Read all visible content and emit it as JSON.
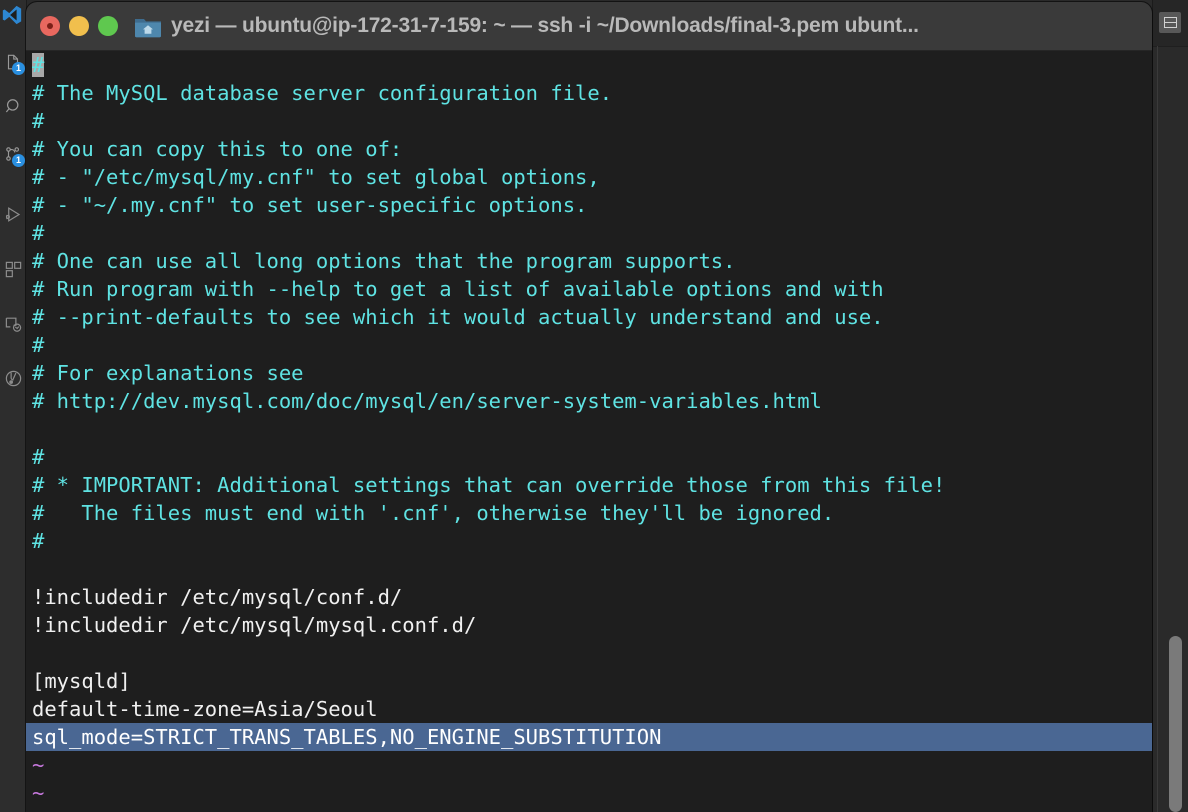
{
  "window": {
    "title": "yezi — ubuntu@ip-172-31-7-159: ~ — ssh -i ~/Downloads/final-3.pem ubunt...",
    "close_label": "Close",
    "minimize_label": "Minimize",
    "maximize_label": "Maximize",
    "folder_icon": "home-folder-icon"
  },
  "vscode": {
    "activity_items": [
      {
        "name": "explorer-icon",
        "badge": "1"
      },
      {
        "name": "search-icon",
        "badge": ""
      },
      {
        "name": "source-control-icon",
        "badge": "1"
      },
      {
        "name": "run-and-debug-icon",
        "badge": ""
      },
      {
        "name": "extensions-icon",
        "badge": ""
      },
      {
        "name": "remote-explorer-icon",
        "badge": ""
      },
      {
        "name": "testing-icon",
        "badge": ""
      }
    ],
    "editor_action": "split-editor-icon"
  },
  "terminal": {
    "program": "vim",
    "colors": {
      "background": "#1e1e1e",
      "comment": "#5fe3e3",
      "text": "#f0f0f0",
      "tilde": "#c678dd",
      "selection": "#4a6793",
      "cursor": "#a8a8a8"
    },
    "lines": [
      {
        "type": "comment",
        "cursor": true,
        "text": "#"
      },
      {
        "type": "comment",
        "text": "# The MySQL database server configuration file."
      },
      {
        "type": "comment",
        "text": "#"
      },
      {
        "type": "comment",
        "text": "# You can copy this to one of:"
      },
      {
        "type": "comment",
        "text": "# - \"/etc/mysql/my.cnf\" to set global options,"
      },
      {
        "type": "comment",
        "text": "# - \"~/.my.cnf\" to set user-specific options."
      },
      {
        "type": "comment",
        "text": "#"
      },
      {
        "type": "comment",
        "text": "# One can use all long options that the program supports."
      },
      {
        "type": "comment",
        "text": "# Run program with --help to get a list of available options and with"
      },
      {
        "type": "comment",
        "text": "# --print-defaults to see which it would actually understand and use."
      },
      {
        "type": "comment",
        "text": "#"
      },
      {
        "type": "comment",
        "text": "# For explanations see"
      },
      {
        "type": "comment",
        "text": "# http://dev.mysql.com/doc/mysql/en/server-system-variables.html"
      },
      {
        "type": "blank",
        "text": ""
      },
      {
        "type": "comment",
        "text": "#"
      },
      {
        "type": "comment",
        "text": "# * IMPORTANT: Additional settings that can override those from this file!"
      },
      {
        "type": "comment",
        "text": "#   The files must end with '.cnf', otherwise they'll be ignored."
      },
      {
        "type": "comment",
        "text": "#"
      },
      {
        "type": "blank",
        "text": ""
      },
      {
        "type": "plain",
        "text": "!includedir /etc/mysql/conf.d/"
      },
      {
        "type": "plain",
        "text": "!includedir /etc/mysql/mysql.conf.d/"
      },
      {
        "type": "blank",
        "text": ""
      },
      {
        "type": "plain",
        "text": "[mysqld]"
      },
      {
        "type": "plain",
        "text": "default-time-zone=Asia/Seoul"
      },
      {
        "type": "plain",
        "selected": true,
        "text": "sql_mode=STRICT_TRANS_TABLES,NO_ENGINE_SUBSTITUTION"
      },
      {
        "type": "tilde",
        "text": "~"
      },
      {
        "type": "tilde",
        "text": "~"
      }
    ]
  }
}
